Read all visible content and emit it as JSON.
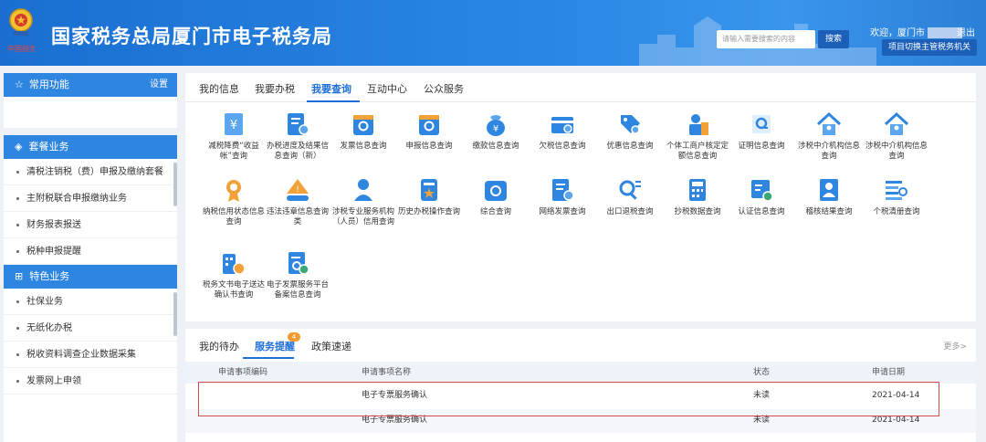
{
  "header": {
    "emblem_text": "中国税务",
    "title": "国家税务总局厦门市电子税务局",
    "search_placeholder": "请输入需要搜索的内容",
    "search_button": "搜索",
    "welcome": "欢迎，厦门市",
    "logout": "退出",
    "switch_button": "项目切换主管税务机关"
  },
  "sidebar": {
    "common_title": "常用功能",
    "settings": "设置",
    "package_title": "套餐业务",
    "package_items": [
      "清税注销税（费）申报及缴纳套餐",
      "主附税联合申报缴纳业务",
      "财务报表报送",
      "税种申报提醒"
    ],
    "special_title": "特色业务",
    "special_items": [
      "社保业务",
      "无纸化办税",
      "税收资料调查企业数据采集",
      "发票网上申领"
    ]
  },
  "main_tabs": [
    "我的信息",
    "我要办税",
    "我要查询",
    "互动中心",
    "公众服务"
  ],
  "tiles": [
    {
      "label": "减税降费“收益帐”查询",
      "icon": "tax-reduction-icon"
    },
    {
      "label": "办税进度及结果信息查询（新）",
      "icon": "progress-query-icon"
    },
    {
      "label": "发票信息查询",
      "icon": "invoice-query-icon"
    },
    {
      "label": "申报信息查询",
      "icon": "declaration-query-icon"
    },
    {
      "label": "缴款信息查询",
      "icon": "payment-bag-icon"
    },
    {
      "label": "欠税信息查询",
      "icon": "arrears-query-icon"
    },
    {
      "label": "优惠信息查询",
      "icon": "discount-tag-icon"
    },
    {
      "label": "个体工商户核定定额信息查询",
      "icon": "individual-business-icon"
    },
    {
      "label": "证明信息查询",
      "icon": "certificate-query-icon"
    },
    {
      "label": "涉税中介机构信息查询",
      "icon": "agency-house-icon"
    },
    {
      "label": "涉税中介机构信息查询",
      "icon": "agency-house-icon-2"
    },
    {
      "label": "纳税信用状态信息查询",
      "icon": "credit-medal-icon"
    },
    {
      "label": "违法违章信息查询类",
      "icon": "violation-warning-icon"
    },
    {
      "label": "涉税专业服务机构（人员）信用查询",
      "icon": "professional-person-icon"
    },
    {
      "label": "历史办税操作查询",
      "icon": "history-operation-icon"
    },
    {
      "label": "综合查询",
      "icon": "comprehensive-query-icon"
    },
    {
      "label": "网络发票查询",
      "icon": "online-invoice-icon"
    },
    {
      "label": "出口退税查询",
      "icon": "export-rebate-icon"
    },
    {
      "label": "抄税数据查询",
      "icon": "calculator-icon"
    },
    {
      "label": "认证信息查询",
      "icon": "verification-icon"
    },
    {
      "label": "稽核结果查询",
      "icon": "audit-result-icon"
    },
    {
      "label": "个税清册查询",
      "icon": "personal-tax-icon"
    },
    {
      "label": "税务文书电子送达确认书查询",
      "icon": "document-delivery-icon"
    },
    {
      "label": "电子发票服务平台备案信息查询",
      "icon": "e-invoice-platform-icon"
    }
  ],
  "bottom_tabs": [
    "我的待办",
    "服务提醒",
    "政策速递"
  ],
  "badge": "4",
  "more": "更多>",
  "table": {
    "headers": [
      "申请事项编码",
      "申请事项名称",
      "状态",
      "申请日期"
    ],
    "rows": [
      {
        "code": "",
        "name": "电子专票服务确认",
        "status": "未读",
        "date": "2021-04-14"
      },
      {
        "code": "",
        "name": "电子专票服务确认",
        "status": "未读",
        "date": "2021-04-14"
      }
    ]
  },
  "colors": {
    "primary": "#1f6fd8",
    "header": "#2a86e4",
    "badge": "#f39a2e",
    "highlight": "#d84a48"
  }
}
